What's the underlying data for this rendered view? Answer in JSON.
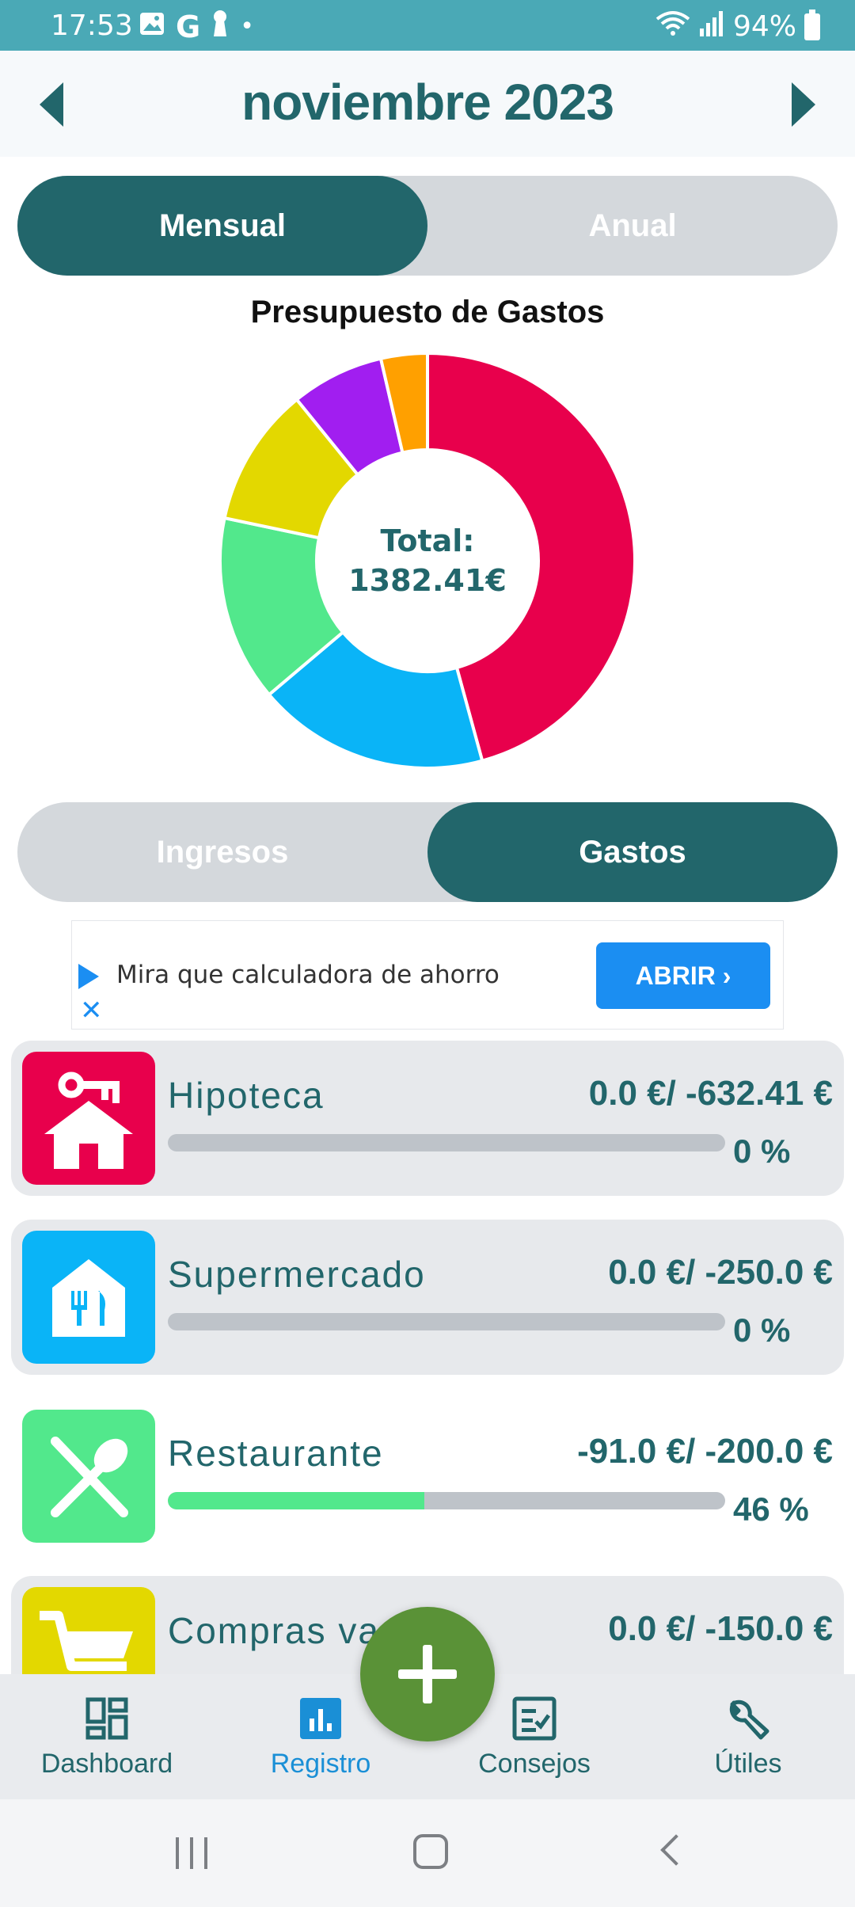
{
  "status_bar": {
    "time": "17:53",
    "notification_icons": [
      "image-icon",
      "google-icon",
      "keyhole-icon",
      "dot-icon"
    ],
    "battery": "94%"
  },
  "header": {
    "month_title": "noviembre 2023",
    "prev_icon": "triangle-left-icon",
    "next_icon": "triangle-right-icon"
  },
  "period_toggle": {
    "monthly": "Mensual",
    "annual": "Anual",
    "selected": "monthly"
  },
  "chart": {
    "title": "Presupuesto de Gastos",
    "total_label": "Total:",
    "total_value": "1382.41€"
  },
  "chart_data": {
    "type": "pie",
    "title": "Presupuesto de Gastos",
    "categories": [
      "Hipoteca",
      "Supermercado",
      "Restaurante",
      "Compras varias",
      "",
      ""
    ],
    "values": [
      632.41,
      250.0,
      200.0,
      150.0,
      100.0,
      50.0
    ],
    "colors": [
      "#e8004c",
      "#0ab4f7",
      "#52e88c",
      "#e3d800",
      "#a11ef0",
      "#ffa000"
    ]
  },
  "type_toggle": {
    "income": "Ingresos",
    "expenses": "Gastos",
    "selected": "expenses"
  },
  "ad": {
    "text": "Mira que calculadora de ahorro",
    "button": "ABRIR",
    "close_icon": "close-icon",
    "ad_icon": "play-icon"
  },
  "categories": [
    {
      "name": "Hipoteca",
      "amount": "0.0 €/ -632.41 €",
      "percent": "0 %",
      "progress": 0,
      "color": "#e8004c",
      "icon": "house-key-icon"
    },
    {
      "name": "Supermercado",
      "amount": "0.0 €/ -250.0 €",
      "percent": "0 %",
      "progress": 0,
      "color": "#0ab4f7",
      "icon": "grocery-store-icon"
    },
    {
      "name": "Restaurante",
      "amount": "-91.0 €/ -200.0 €",
      "percent": "46 %",
      "progress": 46,
      "color": "#52e88c",
      "icon": "fork-spoon-icon"
    },
    {
      "name": "Compras varias",
      "name_visible": "Compras va",
      "amount": "0.0 €/ -150.0 €",
      "percent": "",
      "progress": 0,
      "color": "#e3d800",
      "icon": "shopping-cart-icon"
    }
  ],
  "bottom_nav": [
    {
      "label": "Dashboard",
      "icon": "dashboard-icon"
    },
    {
      "label": "Registro",
      "icon": "bar-chart-icon",
      "active": true
    },
    {
      "label": "Consejos",
      "icon": "checklist-icon"
    },
    {
      "label": "Útiles",
      "icon": "wrench-icon"
    }
  ],
  "fab": {
    "icon": "plus-icon"
  }
}
